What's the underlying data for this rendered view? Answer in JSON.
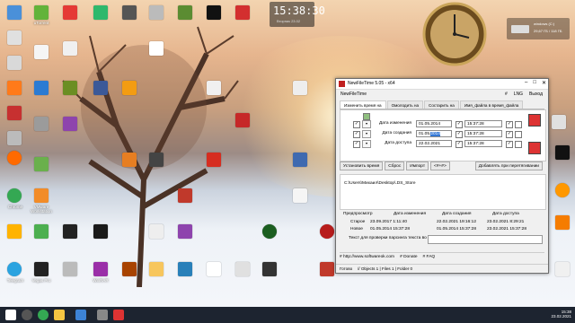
{
  "desktop": {
    "clock_widget": {
      "time": "15:38:30",
      "date": "Вторник 23.02"
    },
    "drive_widget": {
      "name": "windows (C:)",
      "info": "29,67 ГБ / 118 ГБ"
    },
    "icon_labels": [
      "uTorrent",
      "Ф-файлы",
      "Yandex",
      "Minecraft",
      "YouTube",
      "VMware Workstation",
      "WinRAR",
      "Chrome",
      "Firefox",
      "Opera",
      "VLC",
      "Telegram",
      "Vegas Pro"
    ]
  },
  "window": {
    "title": "NewFileTime 5.05 - x64",
    "app_name": "NewFileTime",
    "menu_right": [
      "#",
      "LNG",
      "Выход"
    ],
    "tabs": [
      "Изменить время на",
      "Омолодить на",
      "Состарить на",
      "Имя_файла в время_файла"
    ],
    "rows": [
      {
        "label": "Дата изменения",
        "date": "01.05.2014",
        "time": "15:37:28"
      },
      {
        "label": "Дата создания",
        "date_prefix": "01.05.",
        "date_selected": "2014",
        "time": "15:37:28"
      },
      {
        "label": "Дата доступа",
        "date": "22.02.2021",
        "time": "15:37:28"
      }
    ],
    "buttons": [
      "Установить время",
      "Сброс",
      "Импорт",
      "<#+#>",
      "Добавлять при перетягивании"
    ],
    "path": "C:\\Users\\Михаил\\Desktop\\.DS_Store",
    "table": {
      "headers": [
        "Предпросмотр",
        "Дата изменения",
        "Дата создания",
        "Дата доступа"
      ],
      "rows": [
        {
          "name": "Старое",
          "values": [
            "23.09.2017 1:11:40",
            "22.02.2021 19:16:12",
            "23.02.2021 8:29:21"
          ]
        },
        {
          "name": "Новое",
          "values": [
            "01.05.2014 15:37:28",
            "01.05.2014 15:37:28",
            "23.02.2021 15:37:28"
          ]
        }
      ]
    },
    "check_text_label": "Текст для проверки парсинга текста во время",
    "links": [
      "# http://www.softwareok.com",
      "# Donate",
      "# FAQ"
    ],
    "status": [
      "Готово",
      "// Objects 1 | Files 1 | Folder 0"
    ]
  },
  "taskbar": {
    "tray_time": "15:38",
    "tray_date": "23.02.2021"
  },
  "colors": {
    "selection": "#3478d6",
    "taskbar": "#1d2430"
  }
}
